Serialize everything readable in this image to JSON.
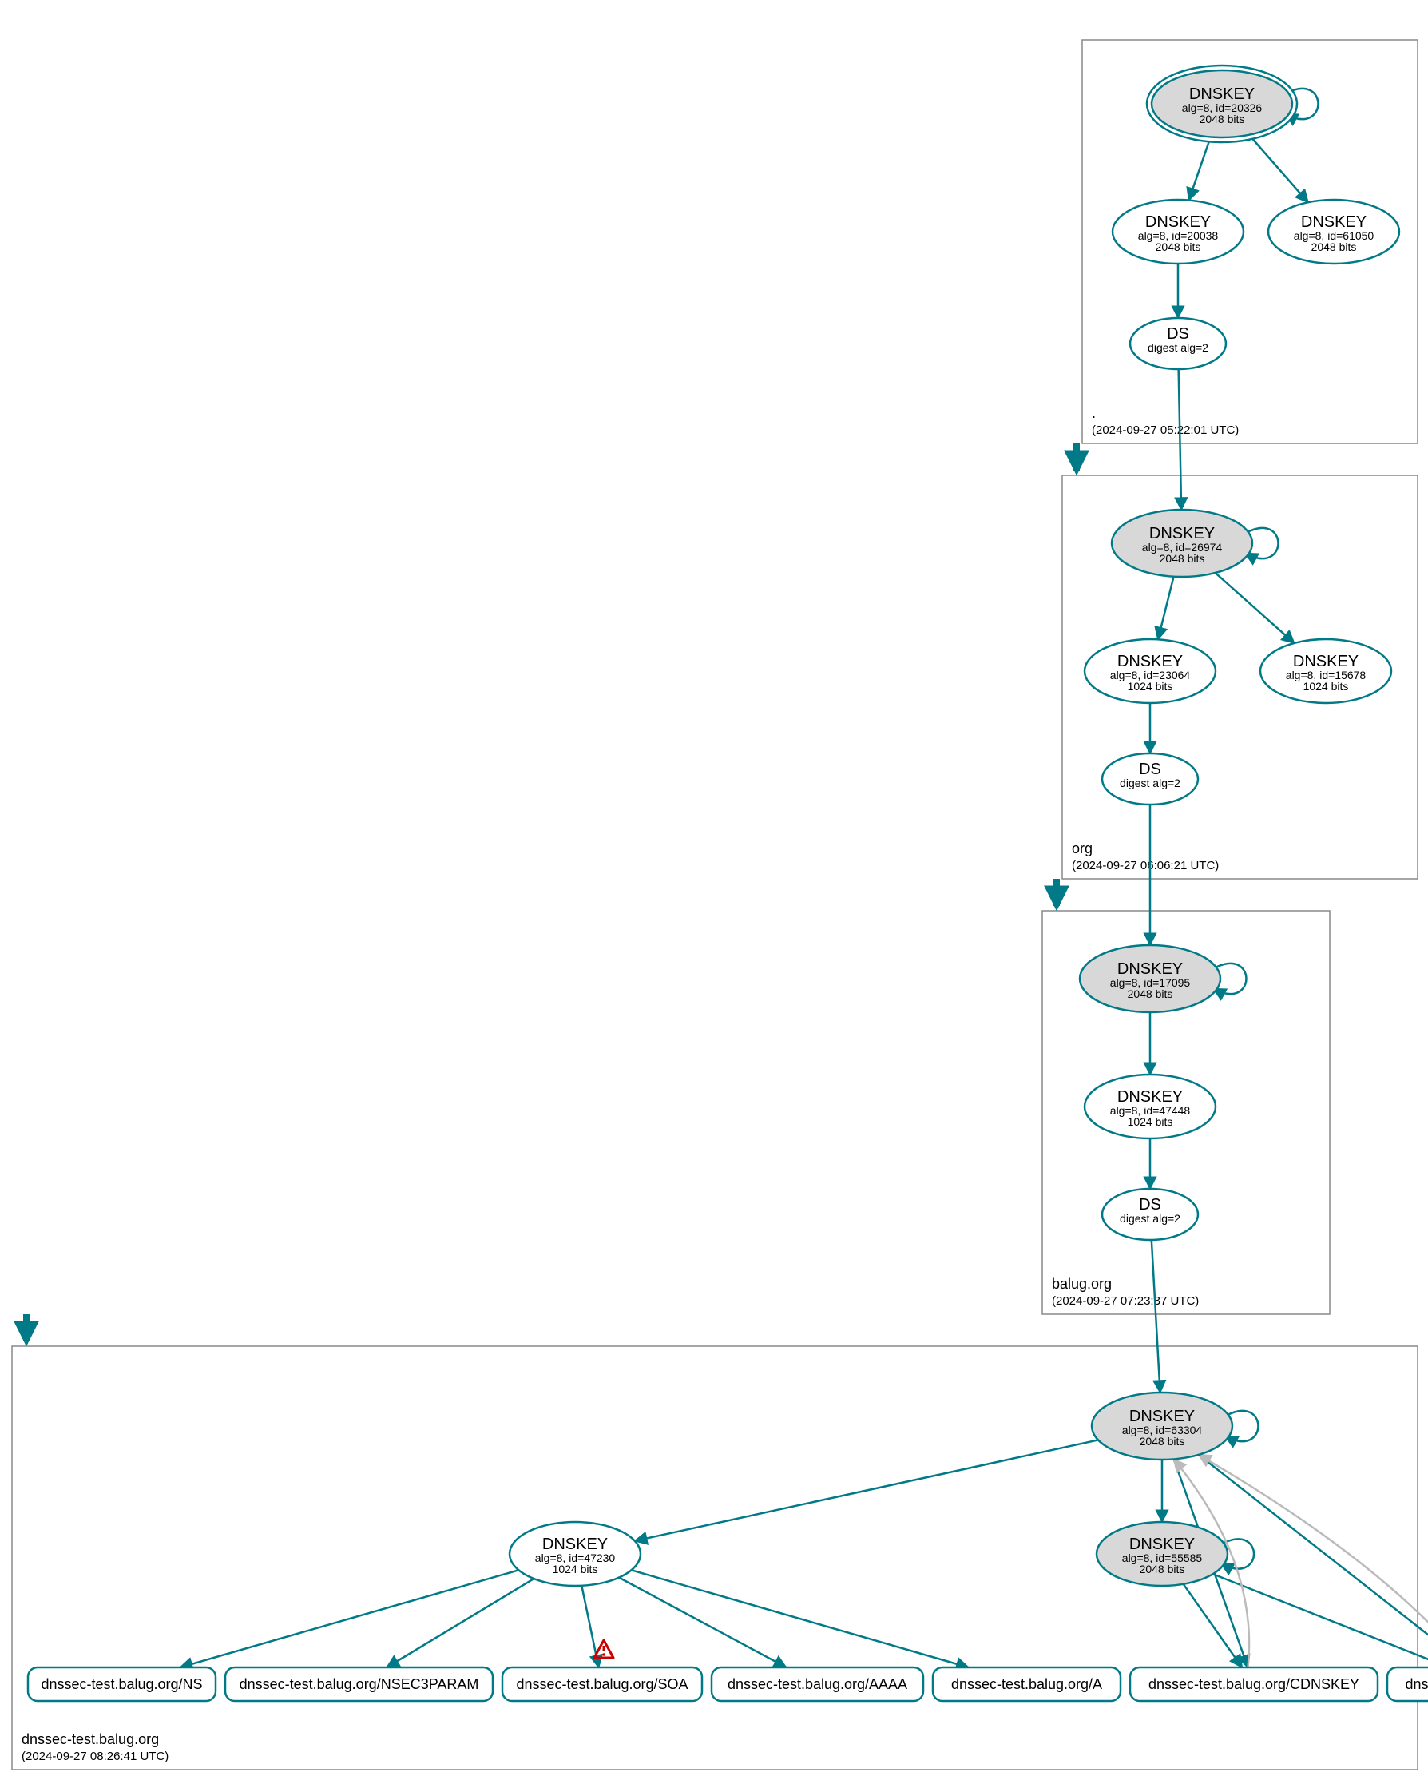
{
  "diagram": {
    "type": "DNSSEC authentication chain graph",
    "zones": [
      {
        "id": "root",
        "name": ".",
        "timestamp": "(2024-09-27 05:22:01 UTC)",
        "nodes": [
          "root-ksk",
          "root-zsk1",
          "root-zsk2",
          "root-ds"
        ]
      },
      {
        "id": "org",
        "name": "org",
        "timestamp": "(2024-09-27 06:06:21 UTC)",
        "nodes": [
          "org-ksk",
          "org-zsk1",
          "org-zsk2",
          "org-ds"
        ]
      },
      {
        "id": "balug",
        "name": "balug.org",
        "timestamp": "(2024-09-27 07:23:37 UTC)",
        "nodes": [
          "balug-ksk",
          "balug-zsk",
          "balug-ds"
        ]
      },
      {
        "id": "dnssec-test",
        "name": "dnssec-test.balug.org",
        "timestamp": "(2024-09-27 08:26:41 UTC)",
        "nodes": [
          "dt-ksk",
          "dt-zsk",
          "dt-zsk2",
          "rr-ns",
          "rr-nsec3",
          "rr-soa",
          "rr-aaaa",
          "rr-a",
          "rr-cdnskey",
          "rr-cds"
        ]
      }
    ],
    "nodes": {
      "root-ksk": {
        "type": "DNSKEY",
        "ksk": true,
        "double_ring": true,
        "l1": "DNSKEY",
        "l2": "alg=8, id=20326",
        "l3": "2048 bits"
      },
      "root-zsk1": {
        "type": "DNSKEY",
        "ksk": false,
        "l1": "DNSKEY",
        "l2": "alg=8, id=20038",
        "l3": "2048 bits"
      },
      "root-zsk2": {
        "type": "DNSKEY",
        "ksk": false,
        "l1": "DNSKEY",
        "l2": "alg=8, id=61050",
        "l3": "2048 bits"
      },
      "root-ds": {
        "type": "DS",
        "l1": "DS",
        "l2": "digest alg=2"
      },
      "org-ksk": {
        "type": "DNSKEY",
        "ksk": true,
        "l1": "DNSKEY",
        "l2": "alg=8, id=26974",
        "l3": "2048 bits"
      },
      "org-zsk1": {
        "type": "DNSKEY",
        "ksk": false,
        "l1": "DNSKEY",
        "l2": "alg=8, id=23064",
        "l3": "1024 bits"
      },
      "org-zsk2": {
        "type": "DNSKEY",
        "ksk": false,
        "l1": "DNSKEY",
        "l2": "alg=8, id=15678",
        "l3": "1024 bits"
      },
      "org-ds": {
        "type": "DS",
        "l1": "DS",
        "l2": "digest alg=2"
      },
      "balug-ksk": {
        "type": "DNSKEY",
        "ksk": true,
        "l1": "DNSKEY",
        "l2": "alg=8, id=17095",
        "l3": "2048 bits"
      },
      "balug-zsk": {
        "type": "DNSKEY",
        "ksk": false,
        "l1": "DNSKEY",
        "l2": "alg=8, id=47448",
        "l3": "1024 bits"
      },
      "balug-ds": {
        "type": "DS",
        "l1": "DS",
        "l2": "digest alg=2"
      },
      "dt-ksk": {
        "type": "DNSKEY",
        "ksk": true,
        "l1": "DNSKEY",
        "l2": "alg=8, id=63304",
        "l3": "2048 bits"
      },
      "dt-zsk": {
        "type": "DNSKEY",
        "ksk": false,
        "l1": "DNSKEY",
        "l2": "alg=8, id=47230",
        "l3": "1024 bits"
      },
      "dt-zsk2": {
        "type": "DNSKEY",
        "ksk": true,
        "l1": "DNSKEY",
        "l2": "alg=8, id=55585",
        "l3": "2048 bits"
      },
      "rr-ns": {
        "type": "RR",
        "label": "dnssec-test.balug.org/NS"
      },
      "rr-nsec3": {
        "type": "RR",
        "label": "dnssec-test.balug.org/NSEC3PARAM"
      },
      "rr-soa": {
        "type": "RR",
        "label": "dnssec-test.balug.org/SOA",
        "warning": true
      },
      "rr-aaaa": {
        "type": "RR",
        "label": "dnssec-test.balug.org/AAAA"
      },
      "rr-a": {
        "type": "RR",
        "label": "dnssec-test.balug.org/A"
      },
      "rr-cdnskey": {
        "type": "RR",
        "label": "dnssec-test.balug.org/CDNSKEY"
      },
      "rr-cds": {
        "type": "RR",
        "label": "dnssec-test.balug.org/CDS"
      }
    },
    "edges": [
      {
        "from": "root-ksk",
        "to": "root-ksk",
        "self": true
      },
      {
        "from": "root-ksk",
        "to": "root-zsk1"
      },
      {
        "from": "root-ksk",
        "to": "root-zsk2"
      },
      {
        "from": "root-zsk1",
        "to": "root-ds"
      },
      {
        "from": "root-ds",
        "to": "org-ksk"
      },
      {
        "from": "org-ksk",
        "to": "org-ksk",
        "self": true
      },
      {
        "from": "org-ksk",
        "to": "org-zsk1"
      },
      {
        "from": "org-ksk",
        "to": "org-zsk2"
      },
      {
        "from": "org-zsk1",
        "to": "org-ds"
      },
      {
        "from": "org-ds",
        "to": "balug-ksk"
      },
      {
        "from": "balug-ksk",
        "to": "balug-ksk",
        "self": true
      },
      {
        "from": "balug-ksk",
        "to": "balug-zsk"
      },
      {
        "from": "balug-zsk",
        "to": "balug-ds"
      },
      {
        "from": "balug-ds",
        "to": "dt-ksk"
      },
      {
        "from": "dt-ksk",
        "to": "dt-ksk",
        "self": true
      },
      {
        "from": "dt-ksk",
        "to": "dt-zsk"
      },
      {
        "from": "dt-ksk",
        "to": "dt-zsk2"
      },
      {
        "from": "dt-zsk2",
        "to": "dt-zsk2",
        "self": true
      },
      {
        "from": "dt-zsk",
        "to": "rr-ns"
      },
      {
        "from": "dt-zsk",
        "to": "rr-nsec3"
      },
      {
        "from": "dt-zsk",
        "to": "rr-soa"
      },
      {
        "from": "dt-zsk",
        "to": "rr-aaaa"
      },
      {
        "from": "dt-zsk",
        "to": "rr-a"
      },
      {
        "from": "dt-ksk",
        "to": "rr-cdnskey"
      },
      {
        "from": "dt-zsk2",
        "to": "rr-cdnskey"
      },
      {
        "from": "dt-ksk",
        "to": "rr-cds"
      },
      {
        "from": "dt-zsk2",
        "to": "rr-cds"
      },
      {
        "from": "rr-cdnskey",
        "to": "dt-ksk",
        "style": "light"
      },
      {
        "from": "rr-cds",
        "to": "dt-ksk",
        "style": "light"
      }
    ]
  }
}
